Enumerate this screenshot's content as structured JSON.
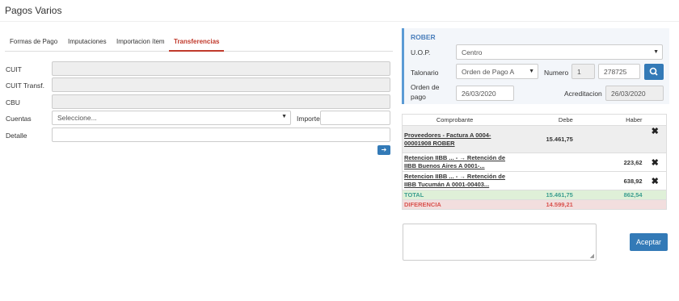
{
  "page": {
    "title": "Pagos Varios"
  },
  "tabs": [
    {
      "label": "Formas de Pago"
    },
    {
      "label": "Imputaciones"
    },
    {
      "label": "Importacion ítem"
    },
    {
      "label": "Transferencias"
    }
  ],
  "form": {
    "cuit_label": "CUIT",
    "cuit_transf_label": "CUIT Transf.",
    "cbu_label": "CBU",
    "cuentas_label": "Cuentas",
    "cuentas_value": "Seleccione...",
    "importe_label": "Importe",
    "detalle_label": "Detalle"
  },
  "panel": {
    "name": "ROBER",
    "uop_label": "U.O.P.",
    "uop_value": "Centro",
    "talonario_label": "Talonario",
    "talonario_value": "Orden de Pago A",
    "numero_label": "Numero",
    "numero_prefix": "1",
    "numero_value": "278725",
    "orden_label_1": "Orden de",
    "orden_label_2": "pago",
    "orden_date": "26/03/2020",
    "acreditacion_label": "Acreditacion",
    "acreditacion_date": "26/03/2020"
  },
  "table": {
    "headers": {
      "comprobante": "Comprobante",
      "debe": "Debe",
      "haber": "Haber"
    },
    "rows": [
      {
        "line1": "Proveedores - Factura A 0004-",
        "line2": "00001908 ROBER",
        "debe": "15.461,75",
        "haber": ""
      },
      {
        "line1": "Retencion IIBB ... - → Retención de",
        "line2": "IIBB Buenos Aires A 0001-...",
        "debe": "",
        "haber": "223,62"
      },
      {
        "line1": "Retencion IIBB ... - → Retención de",
        "line2": "IIBB Tucumán A 0001-00403...",
        "debe": "",
        "haber": "638,92"
      }
    ],
    "total": {
      "label": "TOTAL",
      "debe": "15.461,75",
      "haber": "862,54"
    },
    "diff": {
      "label": "DIFERENCIA",
      "debe": "14.599,21"
    }
  },
  "actions": {
    "accept_label": "Aceptar"
  },
  "icons": {
    "next": "arrow-right-icon",
    "search": "search-icon",
    "delete": "close-icon"
  },
  "colors": {
    "accent": "#337ab7",
    "active_tab": "#c0392b",
    "total_bg": "#dff0d8",
    "diff_bg": "#f2dede"
  }
}
